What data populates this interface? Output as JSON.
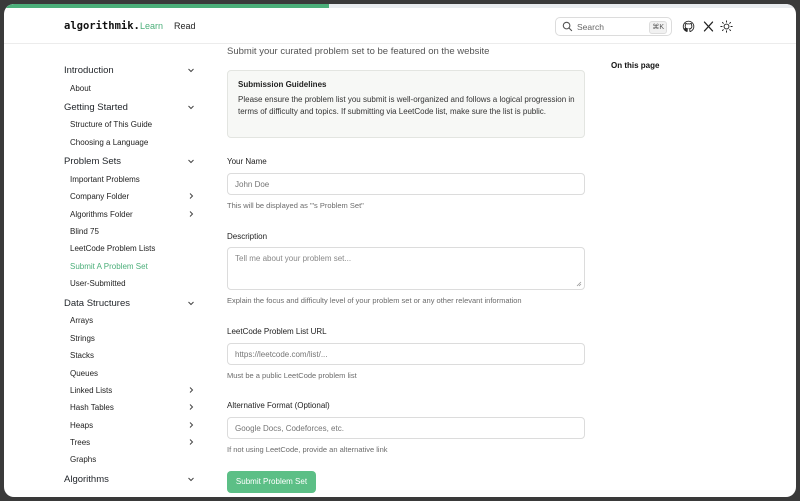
{
  "progress": {
    "fraction": 0.41
  },
  "header": {
    "logo": "algorithmik.",
    "nav": {
      "learn": "Learn",
      "read": "Read"
    },
    "search": {
      "placeholder": "Search",
      "shortcut": "⌘K"
    },
    "icons": [
      "github-icon",
      "x-icon",
      "sun-icon"
    ]
  },
  "sidebar": {
    "sections": [
      {
        "label": "Introduction",
        "items": [
          {
            "label": "About"
          }
        ]
      },
      {
        "label": "Getting Started",
        "items": [
          {
            "label": "Structure of This Guide"
          },
          {
            "label": "Choosing a Language"
          }
        ]
      },
      {
        "label": "Problem Sets",
        "items": [
          {
            "label": "Important Problems"
          },
          {
            "label": "Company Folder",
            "chevron": true
          },
          {
            "label": "Algorithms Folder",
            "chevron": true
          },
          {
            "label": "Blind 75"
          },
          {
            "label": "LeetCode Problem Lists"
          },
          {
            "label": "Submit A Problem Set",
            "active": true
          },
          {
            "label": "User-Submitted"
          }
        ]
      },
      {
        "label": "Data Structures",
        "items": [
          {
            "label": "Arrays"
          },
          {
            "label": "Strings"
          },
          {
            "label": "Stacks"
          },
          {
            "label": "Queues"
          },
          {
            "label": "Linked Lists",
            "chevron": true
          },
          {
            "label": "Hash Tables",
            "chevron": true
          },
          {
            "label": "Heaps",
            "chevron": true
          },
          {
            "label": "Trees",
            "chevron": true
          },
          {
            "label": "Graphs"
          }
        ]
      },
      {
        "label": "Algorithms",
        "items": []
      }
    ]
  },
  "main": {
    "lead": "Submit your curated problem set to be featured on the website",
    "guidelines": {
      "title": "Submission Guidelines",
      "body": "Please ensure the problem list you submit is well-organized and follows a logical progression in terms of difficulty and topics. If submitting via LeetCode list, make sure the list is public."
    },
    "fields": {
      "name": {
        "label": "Your Name",
        "placeholder": "John Doe",
        "help": "This will be displayed as \"'s Problem Set\""
      },
      "description": {
        "label": "Description",
        "placeholder": "Tell me about your problem set...",
        "help": "Explain the focus and difficulty level of your problem set or any other relevant information"
      },
      "url": {
        "label": "LeetCode Problem List URL",
        "placeholder": "https://leetcode.com/list/...",
        "help": "Must be a public LeetCode problem list"
      },
      "alt": {
        "label": "Alternative Format (Optional)",
        "placeholder": "Google Docs, Codeforces, etc.",
        "help": "If not using LeetCode, provide an alternative link"
      }
    },
    "submit_label": "Submit Problem Set",
    "toc_title": "On this page"
  }
}
